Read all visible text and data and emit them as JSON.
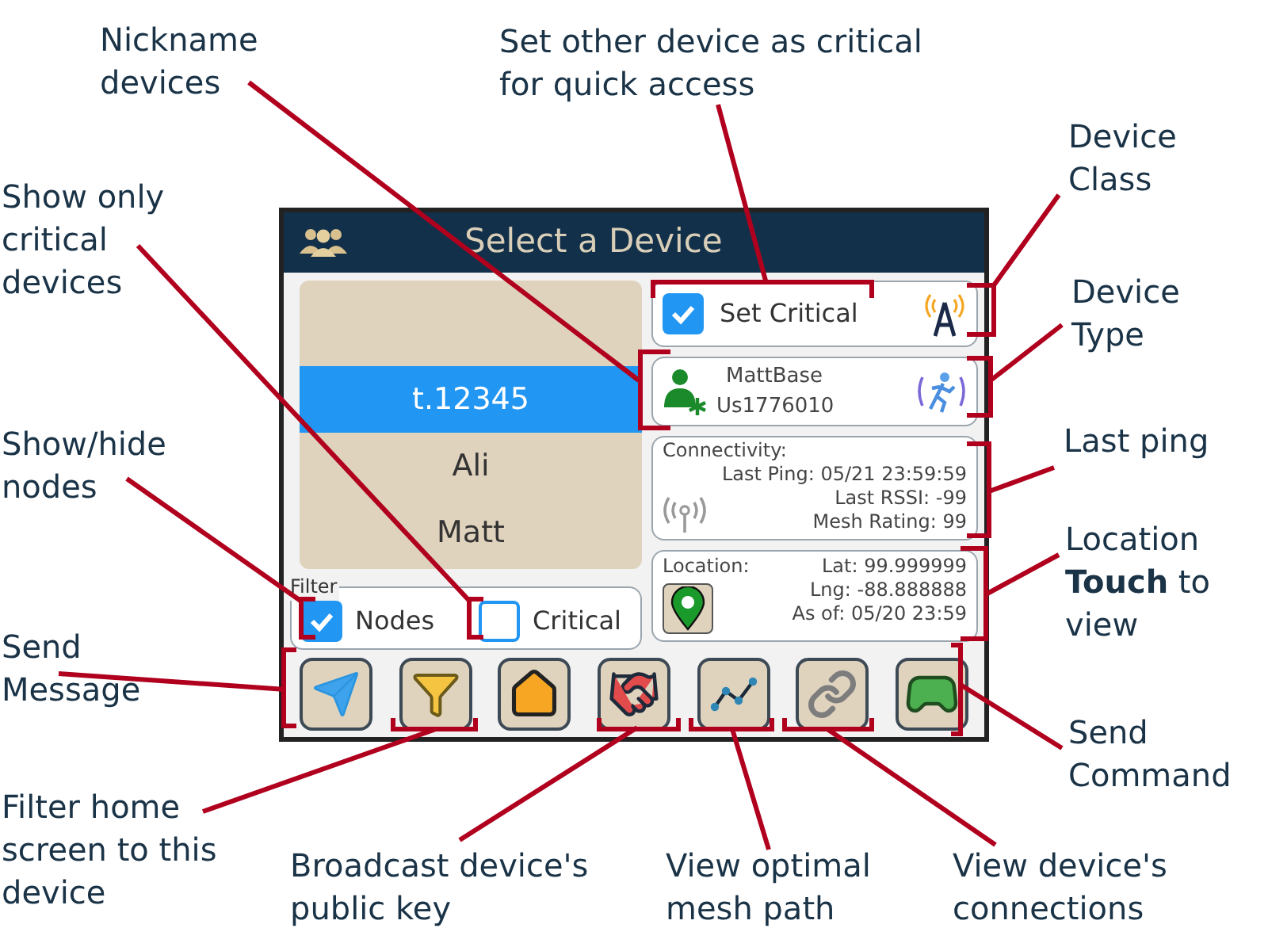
{
  "screen": {
    "title": "Select a Device",
    "device_list": [
      {
        "label": "t.12345",
        "selected": true
      },
      {
        "label": "Ali",
        "selected": false
      },
      {
        "label": "Matt",
        "selected": false
      }
    ],
    "filter": {
      "legend": "Filter",
      "options": [
        {
          "label": "Nodes",
          "checked": true
        },
        {
          "label": "Critical",
          "checked": false
        }
      ]
    },
    "set_critical": {
      "label": "Set Critical",
      "checked": true
    },
    "device": {
      "name": "MattBase",
      "id": "Us1776010"
    },
    "connectivity": {
      "heading": "Connectivity:",
      "lines": [
        "Last Ping: 05/21 23:59:59",
        "Last RSSI: -99",
        "Mesh Rating: 99"
      ]
    },
    "location": {
      "heading": "Location:",
      "lines": [
        "Lat: 99.999999",
        "Lng: -88.888888",
        "As of: 05/20 23:59"
      ]
    },
    "actions": [
      {
        "kind": "send"
      },
      {
        "kind": "filter"
      },
      {
        "kind": "home"
      },
      {
        "kind": "handshake"
      },
      {
        "kind": "path"
      },
      {
        "kind": "link"
      },
      {
        "kind": "gamepad"
      }
    ]
  },
  "annotations": [
    {
      "text": "Nickname\ndevices"
    },
    {
      "text": "Set other device as critical\nfor quick access"
    },
    {
      "text": "Device\nClass"
    },
    {
      "text": "Show only\ncritical\ndevices"
    },
    {
      "text": "Device\nType"
    },
    {
      "text": "Last ping"
    },
    {
      "text": "Show/hide\nnodes"
    },
    {
      "text": "Location **Touch** to\nview"
    },
    {
      "text": "Send\nMessage"
    },
    {
      "text": "Send\nCommand"
    },
    {
      "text": "Filter home\nscreen to this\ndevice"
    },
    {
      "text": "Broadcast device's\npublic key"
    },
    {
      "text": "View optimal\nmesh path"
    },
    {
      "text": "View device's\nconnections"
    }
  ]
}
